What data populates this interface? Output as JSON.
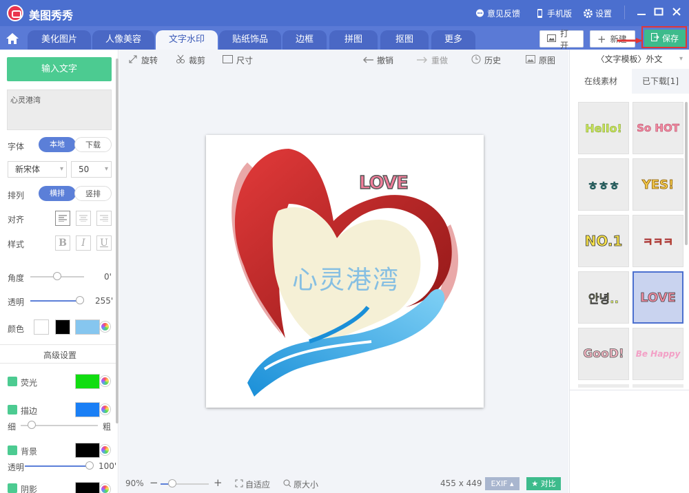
{
  "app": {
    "title": "美图秀秀",
    "feedback": "意见反馈",
    "mobile": "手机版",
    "settings": "设置",
    "colors": {
      "titlebar": "#4b6fcf",
      "accent": "#4ccb91",
      "active_pill": "#5b7fd8"
    }
  },
  "tabs": [
    {
      "label": "美化图片"
    },
    {
      "label": "人像美容"
    },
    {
      "label": "文字水印",
      "active": true
    },
    {
      "label": "贴纸饰品"
    },
    {
      "label": "边框"
    },
    {
      "label": "拼图"
    },
    {
      "label": "抠图"
    },
    {
      "label": "更多"
    }
  ],
  "header": {
    "open": "打开",
    "new": "新建",
    "save": "保存"
  },
  "left": {
    "input_button": "输入文字",
    "text_value": "心灵港湾",
    "font_label": "字体",
    "font_local": "本地",
    "font_download": "下载",
    "font_name": "新宋体",
    "font_size": "50",
    "layout_label": "排列",
    "layout_h": "横排",
    "layout_v": "竖排",
    "align_label": "对齐",
    "style_label": "样式",
    "bold": "B",
    "italic": "I",
    "underline": "U",
    "angle_label": "角度",
    "angle_value": "0'",
    "angle": 0,
    "opacity_label": "透明",
    "opacity_value": "255'",
    "opacity": 1.0,
    "color_label": "颜色",
    "advanced": "高级设置",
    "glow_label": "荧光",
    "glow_color": "#11dd11",
    "stroke_label": "描边",
    "stroke_color": "#1a7ff5",
    "thin": "细",
    "thick": "粗",
    "bg_label": "背景",
    "bg_color": "#000000",
    "bg_opacity_label": "透明",
    "bg_opacity_value": "100'",
    "shadow_label": "阴影"
  },
  "toolbar": {
    "rotate": "旋转",
    "crop": "裁剪",
    "size": "尺寸",
    "undo": "撤销",
    "redo": "重做",
    "history": "历史",
    "original": "原图"
  },
  "canvas": {
    "watermark_text": "心灵港湾",
    "sticker_text": "LOVE"
  },
  "bottom": {
    "zoom": "90%",
    "fit": "自适应",
    "actual": "原大小",
    "dimensions": "455 x 449",
    "exif": "EXIF",
    "compare": "对比"
  },
  "right": {
    "category": "〈文字模板〉外文",
    "tab_online": "在线素材",
    "tab_downloaded": "已下载[1]",
    "thumbs": [
      "Hello!",
      "So HOT",
      "ㅎㅎㅎ",
      "YES!",
      "NO.1",
      "ㅋㅋㅋ",
      "안녕..",
      "LOVE",
      "GooD!",
      "Be Happy"
    ]
  }
}
